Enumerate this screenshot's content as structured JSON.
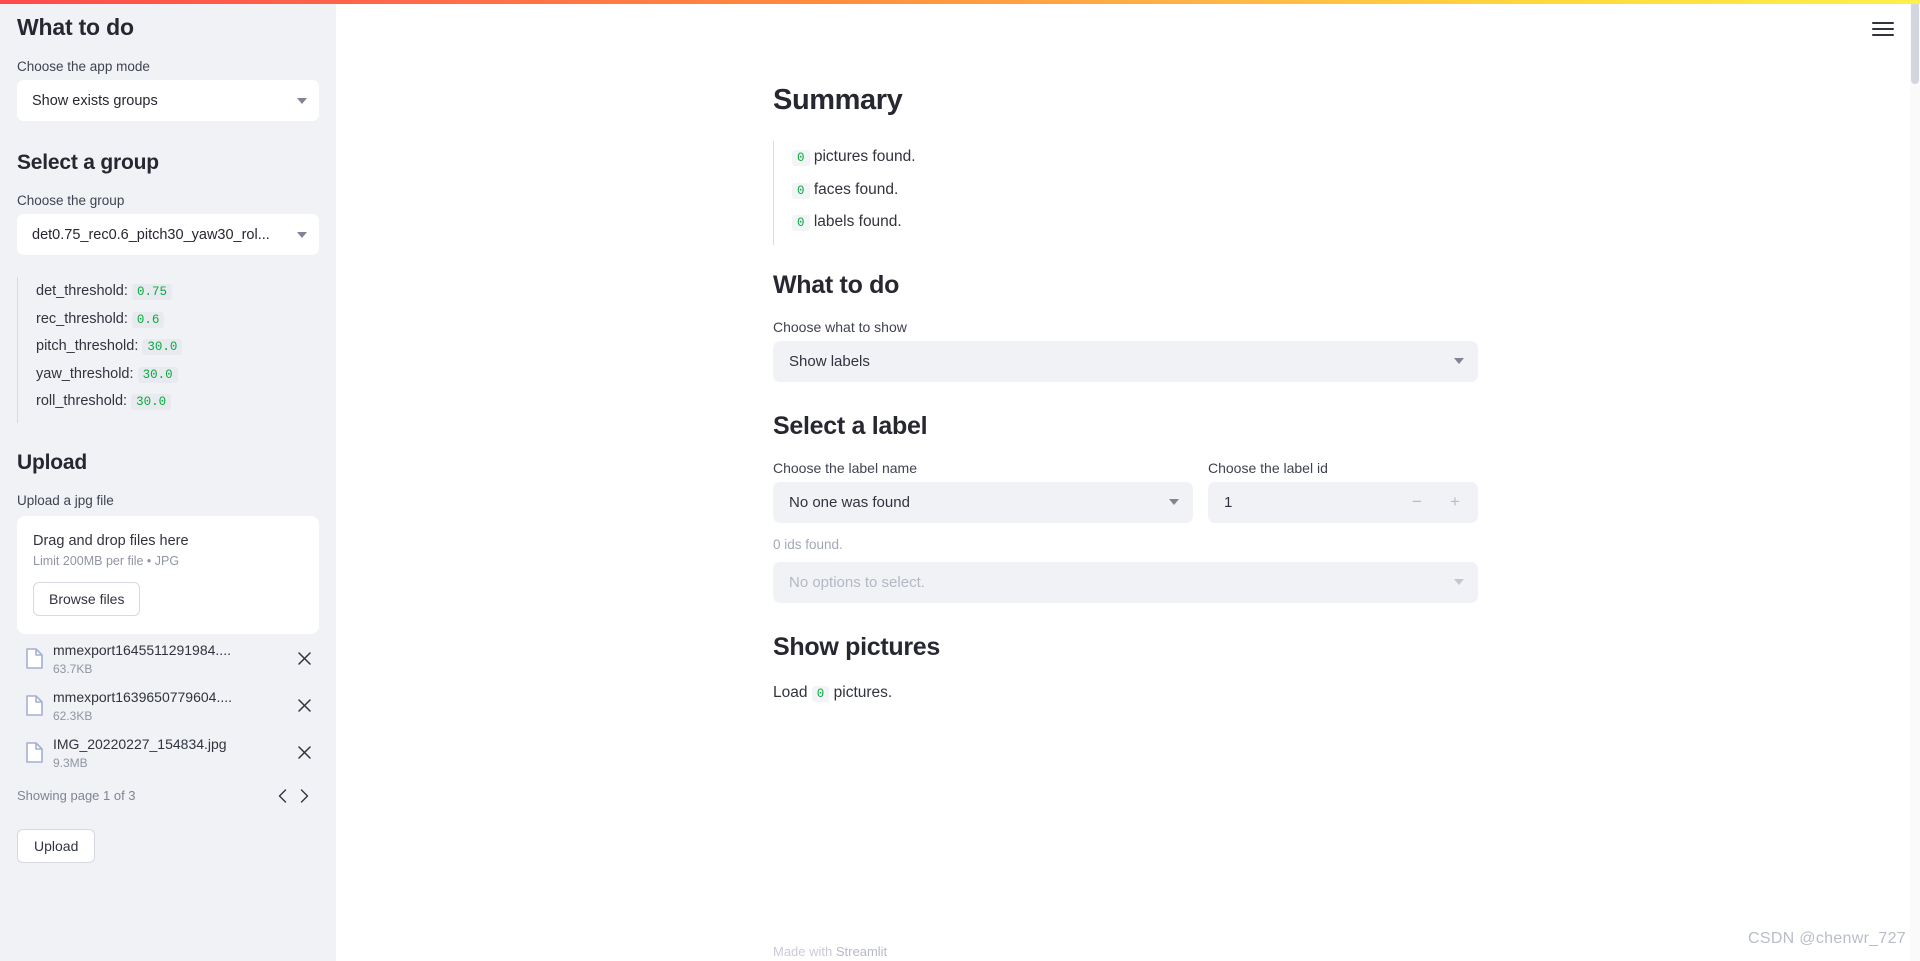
{
  "sidebar": {
    "title": "What to do",
    "app_mode_label": "Choose the app mode",
    "app_mode_value": "Show exists groups",
    "group_title": "Select a group",
    "group_label": "Choose the group",
    "group_value": "det0.75_rec0.6_pitch30_yaw30_rol...",
    "thresholds": [
      {
        "name": "det_threshold:",
        "value": "0.75"
      },
      {
        "name": "rec_threshold:",
        "value": "0.6"
      },
      {
        "name": "pitch_threshold:",
        "value": "30.0"
      },
      {
        "name": "yaw_threshold:",
        "value": "30.0"
      },
      {
        "name": "roll_threshold:",
        "value": "30.0"
      }
    ],
    "upload_title": "Upload",
    "upload_label": "Upload a jpg file",
    "dropzone_title": "Drag and drop files here",
    "dropzone_limit": "Limit 200MB per file • JPG",
    "browse_label": "Browse files",
    "files": [
      {
        "name": "mmexport1645511291984....",
        "size": "63.7KB"
      },
      {
        "name": "mmexport1639650779604....",
        "size": "62.3KB"
      },
      {
        "name": "IMG_20220227_154834.jpg",
        "size": "9.3MB"
      }
    ],
    "pager_text": "Showing page 1 of 3",
    "upload_button": "Upload"
  },
  "main": {
    "summary_title": "Summary",
    "summary_items": [
      {
        "count": "0",
        "text": "pictures found."
      },
      {
        "count": "0",
        "text": "faces found."
      },
      {
        "count": "0",
        "text": "labels found."
      }
    ],
    "what_to_do_title": "What to do",
    "show_label": "Choose what to show",
    "show_value": "Show labels",
    "select_label_title": "Select a label",
    "label_name_label": "Choose the label name",
    "label_name_value": "No one was found",
    "label_id_label": "Choose the label id",
    "label_id_value": "1",
    "ids_found": "0 ids found.",
    "options_value": "No options to select.",
    "show_pictures_title": "Show pictures",
    "load_prefix": "Load",
    "load_count": "0",
    "load_suffix": "pictures."
  },
  "footer": {
    "made_with": "Made with",
    "brand": "Streamlit"
  },
  "watermark": "CSDN @chenwr_727",
  "colors": {
    "accent": "#ff4b4b",
    "code_green": "#09ab3b",
    "sidebar_bg": "#f0f2f6"
  }
}
